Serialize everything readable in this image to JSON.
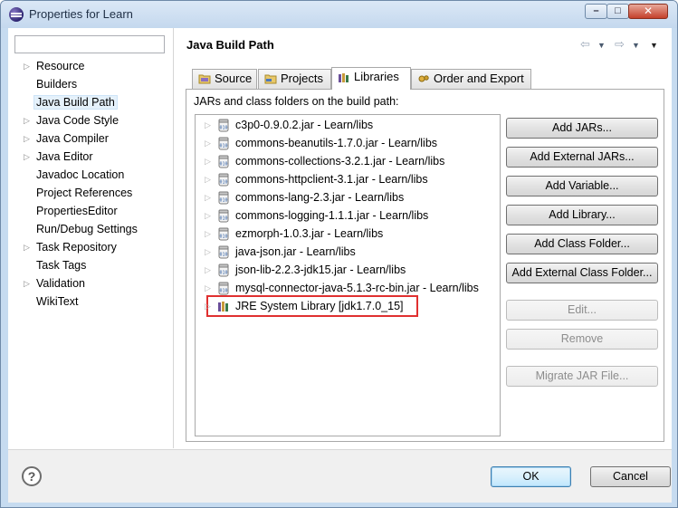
{
  "window": {
    "title": "Properties for Learn",
    "controls": {
      "minimize": "–",
      "maximize": "□",
      "close": "✕"
    }
  },
  "nav": {
    "filter_value": "",
    "items": [
      {
        "label": "Resource",
        "expandable": true
      },
      {
        "label": "Builders",
        "expandable": false
      },
      {
        "label": "Java Build Path",
        "expandable": false,
        "selected": true
      },
      {
        "label": "Java Code Style",
        "expandable": true
      },
      {
        "label": "Java Compiler",
        "expandable": true
      },
      {
        "label": "Java Editor",
        "expandable": true
      },
      {
        "label": "Javadoc Location",
        "expandable": false
      },
      {
        "label": "Project References",
        "expandable": false
      },
      {
        "label": "PropertiesEditor",
        "expandable": false
      },
      {
        "label": "Run/Debug Settings",
        "expandable": false
      },
      {
        "label": "Task Repository",
        "expandable": true
      },
      {
        "label": "Task Tags",
        "expandable": false
      },
      {
        "label": "Validation",
        "expandable": true
      },
      {
        "label": "WikiText",
        "expandable": false
      }
    ]
  },
  "page": {
    "title": "Java Build Path",
    "history": {
      "back": "⇦",
      "back_menu": "▼",
      "forward": "⇨",
      "forward_menu": "▼",
      "view_menu": "▼"
    },
    "tabs": [
      {
        "label": "Source",
        "icon": "source-folder-icon"
      },
      {
        "label": "Projects",
        "icon": "projects-icon"
      },
      {
        "label": "Libraries",
        "icon": "libraries-icon",
        "active": true
      },
      {
        "label": "Order and Export",
        "icon": "order-export-icon"
      }
    ],
    "jars_label": "JARs and class folders on the build path:",
    "entries": [
      {
        "label": "c3p0-0.9.0.2.jar - Learn/libs",
        "icon": "jar-icon"
      },
      {
        "label": "commons-beanutils-1.7.0.jar - Learn/libs",
        "icon": "jar-icon"
      },
      {
        "label": "commons-collections-3.2.1.jar - Learn/libs",
        "icon": "jar-icon"
      },
      {
        "label": "commons-httpclient-3.1.jar - Learn/libs",
        "icon": "jar-icon"
      },
      {
        "label": "commons-lang-2.3.jar - Learn/libs",
        "icon": "jar-icon"
      },
      {
        "label": "commons-logging-1.1.1.jar - Learn/libs",
        "icon": "jar-icon"
      },
      {
        "label": "ezmorph-1.0.3.jar - Learn/libs",
        "icon": "jar-icon"
      },
      {
        "label": "java-json.jar - Learn/libs",
        "icon": "jar-icon"
      },
      {
        "label": "json-lib-2.2.3-jdk15.jar - Learn/libs",
        "icon": "jar-icon"
      },
      {
        "label": "mysql-connector-java-5.1.3-rc-bin.jar - Learn/libs",
        "icon": "jar-icon"
      },
      {
        "label": "JRE System Library [jdk1.7.0_15]",
        "icon": "library-icon",
        "highlighted": true
      }
    ],
    "buttons": [
      {
        "label": "Add JARs...",
        "enabled": true
      },
      {
        "label": "Add External JARs...",
        "enabled": true
      },
      {
        "label": "Add Variable...",
        "enabled": true
      },
      {
        "label": "Add Library...",
        "enabled": true
      },
      {
        "label": "Add Class Folder...",
        "enabled": true
      },
      {
        "label": "Add External Class Folder...",
        "enabled": true
      },
      {
        "label": "Edit...",
        "enabled": false
      },
      {
        "label": "Remove",
        "enabled": false
      },
      {
        "label": "Migrate JAR File...",
        "enabled": false
      }
    ]
  },
  "footer": {
    "help": "?",
    "ok_label": "OK",
    "cancel_label": "Cancel"
  },
  "colors": {
    "highlight_border": "#e03030",
    "selection": "#e5f1fb",
    "window_frame": "#c6dbf0"
  }
}
